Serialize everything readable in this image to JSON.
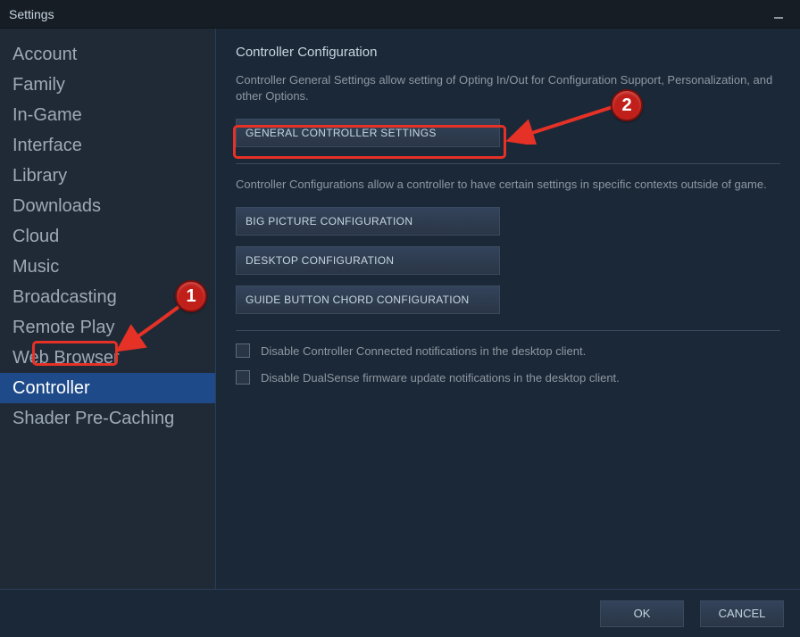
{
  "window": {
    "title": "Settings"
  },
  "sidebar": {
    "items": [
      {
        "label": "Account",
        "selected": false
      },
      {
        "label": "Family",
        "selected": false
      },
      {
        "label": "In-Game",
        "selected": false
      },
      {
        "label": "Interface",
        "selected": false
      },
      {
        "label": "Library",
        "selected": false
      },
      {
        "label": "Downloads",
        "selected": false
      },
      {
        "label": "Cloud",
        "selected": false
      },
      {
        "label": "Music",
        "selected": false
      },
      {
        "label": "Broadcasting",
        "selected": false
      },
      {
        "label": "Remote Play",
        "selected": false
      },
      {
        "label": "Web Browser",
        "selected": false
      },
      {
        "label": "Controller",
        "selected": true
      },
      {
        "label": "Shader Pre-Caching",
        "selected": false
      }
    ]
  },
  "main": {
    "heading": "Controller Configuration",
    "desc1": "Controller General Settings allow setting of Opting In/Out for Configuration Support, Personalization, and other Options.",
    "button_general": "GENERAL CONTROLLER SETTINGS",
    "desc2": "Controller Configurations allow a controller to have certain settings in specific contexts outside of game.",
    "button_bigpicture": "BIG PICTURE CONFIGURATION",
    "button_desktop": "DESKTOP CONFIGURATION",
    "button_guide": "GUIDE BUTTON CHORD CONFIGURATION",
    "checkbox1_label": "Disable Controller Connected notifications in the desktop client.",
    "checkbox2_label": "Disable DualSense firmware update notifications in the desktop client."
  },
  "footer": {
    "ok": "OK",
    "cancel": "CANCEL"
  },
  "annotations": {
    "badge1": "1",
    "badge2": "2"
  }
}
